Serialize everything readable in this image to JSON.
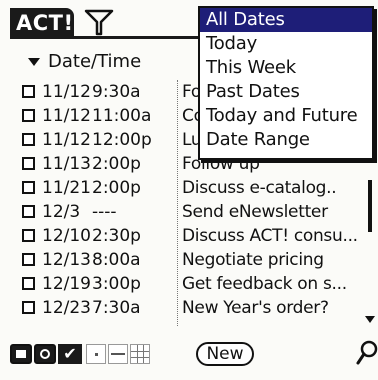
{
  "app": {
    "title": "ACT!"
  },
  "header": {
    "sort_column": "Date/Time"
  },
  "rows": [
    {
      "date": "11/12",
      "time": "9:30a",
      "desc": "Fo"
    },
    {
      "date": "11/12",
      "time": "11:00a",
      "desc": "Co"
    },
    {
      "date": "11/12",
      "time": "12:00p",
      "desc": "Lu"
    },
    {
      "date": "11/13",
      "time": "2:00p",
      "desc": "Follow up"
    },
    {
      "date": "11/21",
      "time": "2:00p",
      "desc": "Discuss e-catalog.."
    },
    {
      "date": "12/3",
      "time": "----",
      "desc": "Send eNewsletter"
    },
    {
      "date": "12/10",
      "time": "2:30p",
      "desc": "Discuss ACT! consu..."
    },
    {
      "date": "12/13",
      "time": "8:00a",
      "desc": "Negotiate pricing"
    },
    {
      "date": "12/19",
      "time": "3:00p",
      "desc": "Get feedback on s..."
    },
    {
      "date": "12/23",
      "time": "7:30a",
      "desc": "New Year's order?"
    }
  ],
  "date_filter_menu": {
    "selected_index": 0,
    "items": [
      "All Dates",
      "Today",
      "This Week",
      "Past Dates",
      "Today and Future",
      "Date Range"
    ]
  },
  "toolbar": {
    "new_label": "New",
    "check_glyph": "✔"
  },
  "colors": {
    "selection": "#1e1e78",
    "ink": "#111111"
  }
}
